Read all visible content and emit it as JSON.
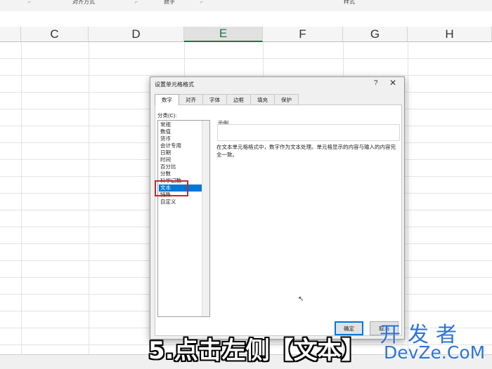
{
  "ribbon": {
    "groups": [
      "对齐方式",
      "数字",
      "样式"
    ]
  },
  "columns": [
    {
      "label": "C",
      "selected": false
    },
    {
      "label": "D",
      "selected": false
    },
    {
      "label": "E",
      "selected": true
    },
    {
      "label": "F",
      "selected": false
    },
    {
      "label": "G",
      "selected": false
    },
    {
      "label": "H",
      "selected": false
    }
  ],
  "dialog": {
    "title": "设置单元格格式",
    "help": "?",
    "close": "✕",
    "tabs": [
      "数字",
      "对齐",
      "字体",
      "边框",
      "填充",
      "保护"
    ],
    "active_tab": "数字",
    "category_label": "分类(C):",
    "categories": [
      "常规",
      "数值",
      "货币",
      "会计专用",
      "日期",
      "时间",
      "百分比",
      "分数",
      "科学记数",
      "文本",
      "特殊",
      "自定义"
    ],
    "selected_category": "文本",
    "sample_label": "示例",
    "description": "在文本单元格格式中，数字作为文本处理。单元格显示的内容与输入的内容完全一致。",
    "ok_label": "确定",
    "cancel_label": "取消"
  },
  "caption": "5.点击左侧【文本】",
  "watermark": {
    "cn": "开发者",
    "en": "DevZe.CoM"
  },
  "colors": {
    "accent_green": "#217346",
    "selection_blue": "#0078d7",
    "highlight_red": "#c0282e",
    "watermark_blue": "#2d74d6"
  }
}
